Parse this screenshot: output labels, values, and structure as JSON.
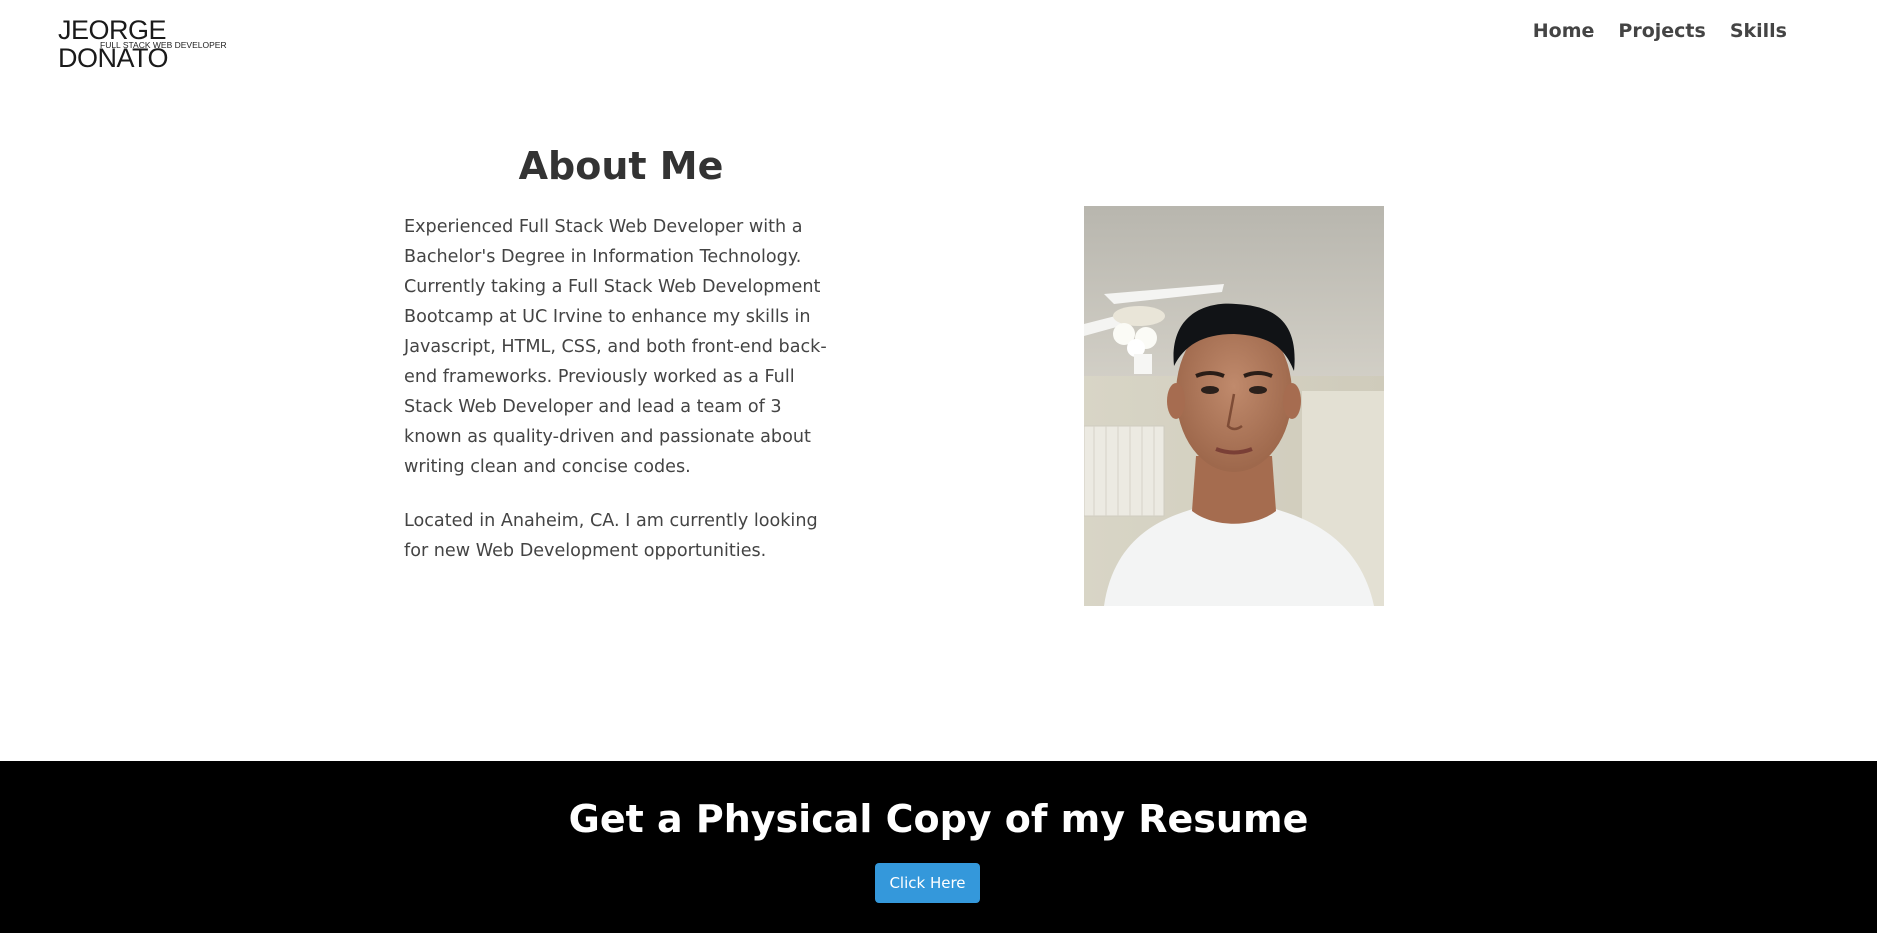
{
  "header": {
    "logo": {
      "name": "JEORGE DONATO",
      "tagline": "FULL STACK WEB DEVELOPER"
    },
    "nav": [
      {
        "label": "Home"
      },
      {
        "label": "Projects"
      },
      {
        "label": "Skills"
      }
    ]
  },
  "about": {
    "title": "About Me",
    "paragraphs": [
      "Experienced Full Stack Web Developer with a Bachelor's Degree in Information Technology. Currently taking a Full Stack Web Development Bootcamp at UC Irvine to enhance my skills in Javascript, HTML, CSS, and both front-end back-end frameworks. Previously worked as a Full Stack Web Developer and lead a team of 3 known as quality-driven and passionate about writing clean and concise codes.",
      "Located in Anaheim, CA. I am currently looking for new Web Development opportunities."
    ]
  },
  "resume": {
    "title": "Get a Physical Copy of my Resume",
    "button_label": "Click Here"
  },
  "colors": {
    "accent": "#3498db",
    "banner_bg": "#000000",
    "text": "#333333"
  }
}
